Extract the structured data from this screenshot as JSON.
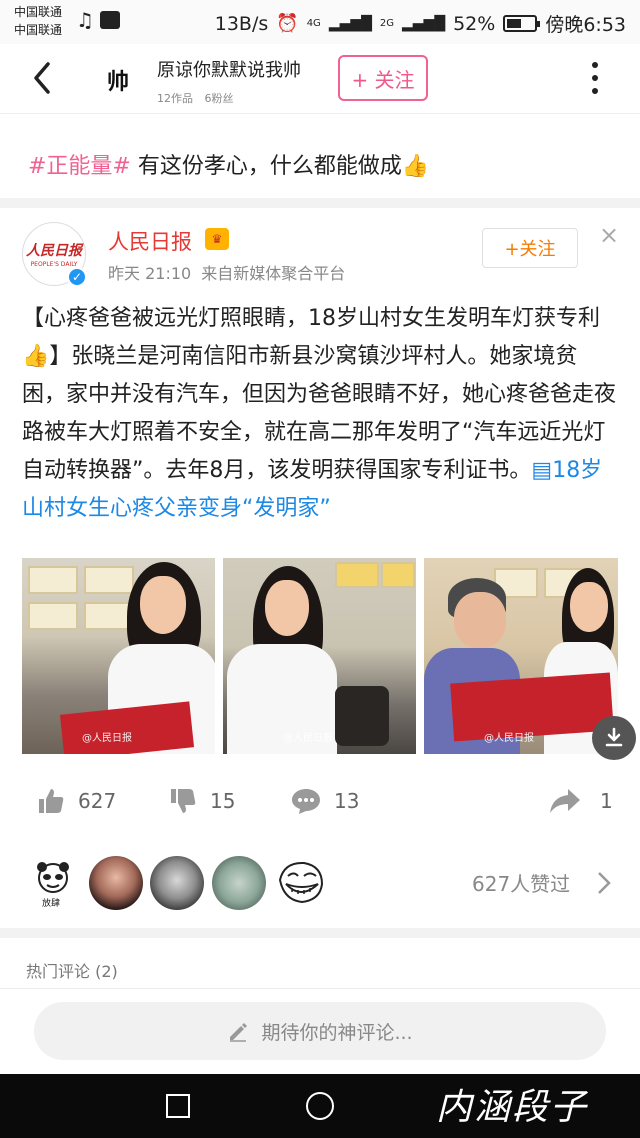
{
  "status_bar": {
    "carrier_1": "中国联通",
    "carrier_2": "中国联通",
    "speed": "13B/s",
    "net_1": "4G",
    "net_2": "2G",
    "battery": "52%",
    "battery_level": 0.52,
    "time": "傍晚6:53"
  },
  "header": {
    "avatar_text": "帅",
    "title": "原谅你默默说我帅",
    "works": "12作品",
    "fans": "6粉丝",
    "follow_label": "+ 关注"
  },
  "post": {
    "hashtag": "#正能量#",
    "text": " 有这份孝心，什么都能做成👍"
  },
  "source": {
    "logo_cn": "人民日报",
    "logo_en": "PEOPLE'S DAILY",
    "name": "人民日报",
    "time": "昨天 21:10",
    "via": "来自新媒体聚合平台",
    "follow_label": "+关注",
    "close": "×"
  },
  "body": {
    "text": "【心疼爸爸被远光灯照眼睛，18岁山村女生发明车灯获专利👍】张晓兰是河南信阳市新县沙窝镇沙坪村人。她家境贫困，家中并没有汽车，但因为爸爸眼睛不好，她心疼爸爸走夜路被车大灯照着不安全，就在高二那年发明了“汽车远近光灯自动转换器”。去年8月，该发明获得国家专利证书。",
    "link": "▤18岁山村女生心疼父亲变身“发明家”"
  },
  "photos": {
    "watermark": "@人民日报"
  },
  "actions": {
    "likes": "627",
    "dislikes": "15",
    "comments": "13",
    "shares": "1"
  },
  "likers": {
    "liker1_caption": "放肆",
    "summary": "627人赞过"
  },
  "comments": {
    "hot_title": "热门评论 (2)",
    "input_placeholder": "期待你的神评论..."
  },
  "nav": {
    "watermark": "内涵段子"
  }
}
